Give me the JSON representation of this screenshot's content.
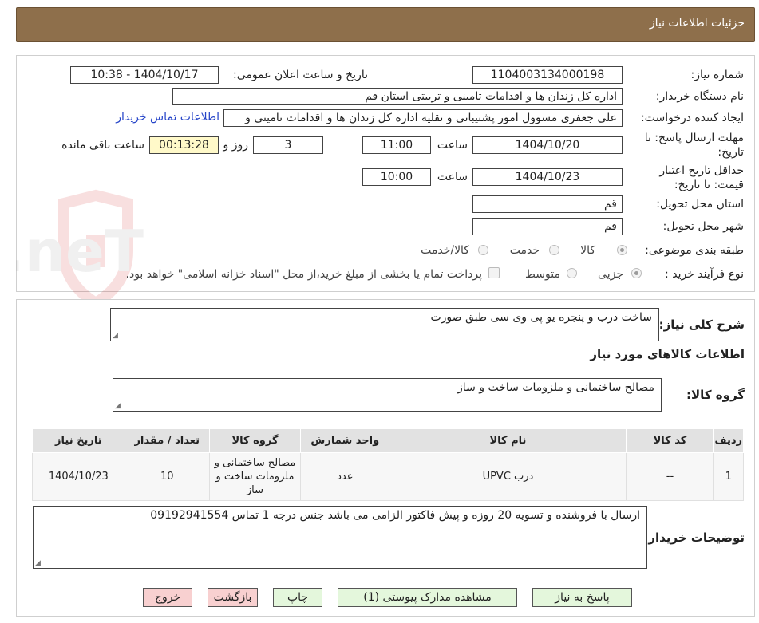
{
  "header": {
    "title": "جزئیات اطلاعات نیاز"
  },
  "fields": {
    "need_number_label": "شماره نیاز:",
    "need_number": "1104003134000198",
    "announce_label": "تاریخ و ساعت اعلان عمومی:",
    "announce_value": "1404/10/17 - 10:38",
    "buyer_label": "نام دستگاه خریدار:",
    "buyer_value": "اداره کل زندان ها و اقدامات تامینی و تربیتی استان قم",
    "creator_label": "ایجاد کننده درخواست:",
    "creator_value": "علی جعفری مسوول امور پشتیبانی و نقلیه اداره کل زندان ها و اقدامات تامینی و",
    "contact_link": "اطلاعات تماس خریدار",
    "deadline_label_1": "مهلت ارسال پاسخ: تا",
    "deadline_label_2": "تاریخ:",
    "deadline_date": "1404/10/20",
    "hour_label": "ساعت",
    "deadline_hour": "11:00",
    "days_value": "3",
    "days_label": "روز و",
    "remaining_value": "00:13:28",
    "remaining_label": "ساعت باقی مانده",
    "validity_label_1": "حداقل تاریخ اعتبار",
    "validity_label_2": "قیمت: تا تاریخ:",
    "validity_date": "1404/10/23",
    "validity_hour": "10:00",
    "province_label": "استان محل تحویل:",
    "province_value": "قم",
    "city_label": "شهر محل تحویل:",
    "city_value": "قم",
    "category_label": "طبقه بندی موضوعی:",
    "category_options": [
      "کالا",
      "خدمت",
      "کالا/خدمت"
    ],
    "process_label": "نوع فرآیند خرید :",
    "process_options": [
      "جزیی",
      "متوسط"
    ],
    "payment_note": "پرداخت تمام یا بخشی از مبلغ خرید،از محل \"اسناد خزانه اسلامی\" خواهد بود."
  },
  "watermark_text": "AriaTender.neT",
  "description": {
    "label": "شرح کلی نیاز:",
    "value": "ساخت درب و پنجره یو پی وی سی طبق صورت"
  },
  "goods_section_title": "اطلاعات کالاهای مورد نیاز",
  "goods_group": {
    "label": "گروه کالا:",
    "value": "مصالح ساختمانی و ملزومات ساخت و ساز"
  },
  "table": {
    "headers": [
      "ردیف",
      "کد کالا",
      "نام کالا",
      "واحد شمارش",
      "گروه کالا",
      "تعداد / مقدار",
      "تاریخ نیاز"
    ],
    "rows": [
      [
        "1",
        "--",
        "درب UPVC",
        "عدد",
        "مصالح ساختمانی و ملزومات ساخت و ساز",
        "10",
        "1404/10/23"
      ]
    ]
  },
  "buyer_notes": {
    "label": "توضیحات خریدار:",
    "value": "ارسال با فروشنده و تسویه 20 روزه و پیش فاکتور الزامی می باشد جنس درجه  1 تماس  09192941554"
  },
  "buttons": {
    "respond": "پاسخ به نیاز",
    "attachments": "مشاهده مدارک پیوستی (1)",
    "print": "چاپ",
    "back": "بازگشت",
    "exit": "خروج"
  }
}
